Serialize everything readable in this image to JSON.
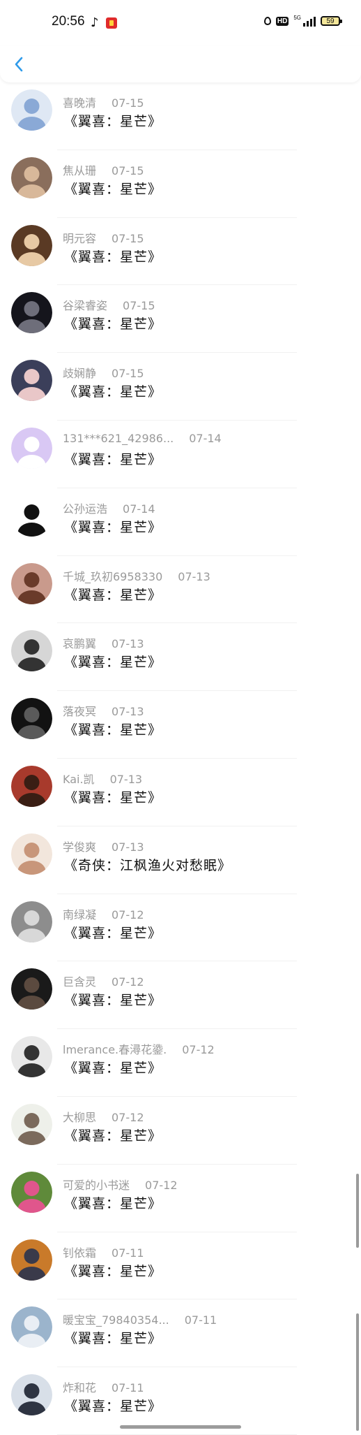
{
  "status_bar": {
    "time": "20:56",
    "network_label": "5G",
    "hd_label": "HD",
    "battery_level": "59"
  },
  "colors": {
    "accent": "#2f9bea",
    "meta_text": "#9a9a9a",
    "title_text": "#111111"
  },
  "rows": [
    {
      "name": "喜晚清",
      "date": "07-15",
      "title": "《翼喜：星芒》",
      "avatar_bg": "#dfe8f4",
      "avatar_fg": "#8aa9d6"
    },
    {
      "name": "焦从珊",
      "date": "07-15",
      "title": "《翼喜：星芒》",
      "avatar_bg": "#8a6e5c",
      "avatar_fg": "#d8b89a"
    },
    {
      "name": "明元容",
      "date": "07-15",
      "title": "《翼喜：星芒》",
      "avatar_bg": "#5a3a24",
      "avatar_fg": "#e7c9a4"
    },
    {
      "name": "谷梁睿姿",
      "date": "07-15",
      "title": "《翼喜：星芒》",
      "avatar_bg": "#15151c",
      "avatar_fg": "#6e6e7a"
    },
    {
      "name": "歧娴静",
      "date": "07-15",
      "title": "《翼喜：星芒》",
      "avatar_bg": "#3b3f5a",
      "avatar_fg": "#e9c7c8"
    },
    {
      "name": "131***621_42986...",
      "date": "07-14",
      "title": "《翼喜：星芒》",
      "avatar_bg": "#d9c8f4",
      "avatar_fg": "#ffffff"
    },
    {
      "name": "公孙运浩",
      "date": "07-14",
      "title": "《翼喜：星芒》",
      "avatar_bg": "#ffffff",
      "avatar_fg": "#111111"
    },
    {
      "name": "千城_玖初6958330",
      "date": "07-13",
      "title": "《翼喜：星芒》",
      "avatar_bg": "#c99a8c",
      "avatar_fg": "#6a3b2a"
    },
    {
      "name": "哀鹏翼",
      "date": "07-13",
      "title": "《翼喜：星芒》",
      "avatar_bg": "#d6d6d6",
      "avatar_fg": "#333333"
    },
    {
      "name": "落夜冥",
      "date": "07-13",
      "title": "《翼喜：星芒》",
      "avatar_bg": "#121212",
      "avatar_fg": "#5a5a5a"
    },
    {
      "name": "Kai.凯",
      "date": "07-13",
      "title": "《翼喜：星芒》",
      "avatar_bg": "#a83a2c",
      "avatar_fg": "#3a1e14"
    },
    {
      "name": "学俊爽",
      "date": "07-13",
      "title": "《奇侠：江枫渔火对愁眠》",
      "avatar_bg": "#f2e6dc",
      "avatar_fg": "#c8967a"
    },
    {
      "name": "南绿凝",
      "date": "07-12",
      "title": "《翼喜：星芒》",
      "avatar_bg": "#8d8d8d",
      "avatar_fg": "#d8d8d8"
    },
    {
      "name": "巨含灵",
      "date": "07-12",
      "title": "《翼喜：星芒》",
      "avatar_bg": "#1a1a1a",
      "avatar_fg": "#5b4a3f"
    },
    {
      "name": "lmerance.春潯花鍌.",
      "date": "07-12",
      "title": "《翼喜：星芒》",
      "avatar_bg": "#e8e8e8",
      "avatar_fg": "#333333"
    },
    {
      "name": "大柳思",
      "date": "07-12",
      "title": "《翼喜：星芒》",
      "avatar_bg": "#eef0ea",
      "avatar_fg": "#7b6a5c"
    },
    {
      "name": "可爱的小书迷",
      "date": "07-12",
      "title": "《翼喜：星芒》",
      "avatar_bg": "#5f8a3a",
      "avatar_fg": "#e0568c"
    },
    {
      "name": "钊依霜",
      "date": "07-11",
      "title": "《翼喜：星芒》",
      "avatar_bg": "#c97a2a",
      "avatar_fg": "#3a3a4a"
    },
    {
      "name": "暖宝宝_79840354...",
      "date": "07-11",
      "title": "《翼喜：星芒》",
      "avatar_bg": "#9bb4cc",
      "avatar_fg": "#e9eef4"
    },
    {
      "name": "炸和花",
      "date": "07-11",
      "title": "《翼喜：星芒》",
      "avatar_bg": "#d8dfe8",
      "avatar_fg": "#2e3442"
    }
  ]
}
